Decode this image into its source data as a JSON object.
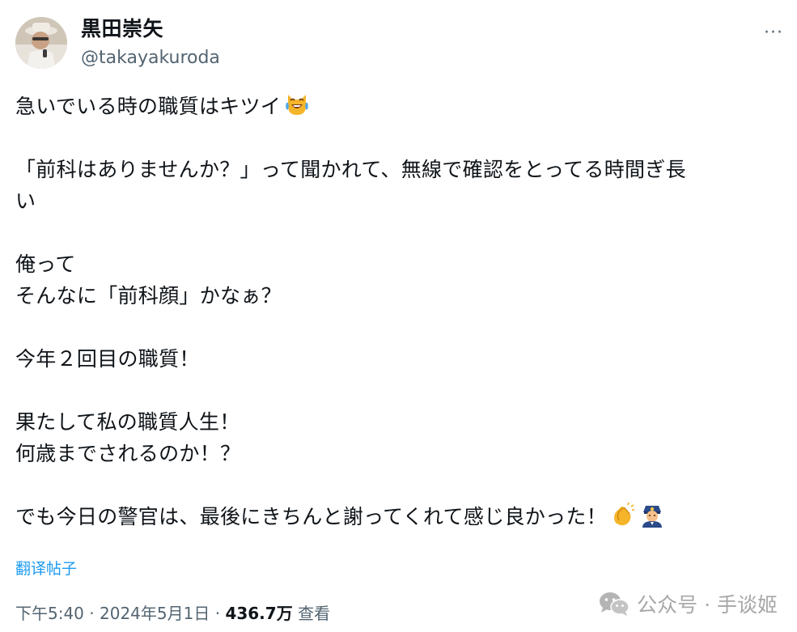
{
  "author": {
    "display_name": "黒田崇矢",
    "handle": "@takayakuroda"
  },
  "more_label": "···",
  "tweet": {
    "paragraphs": [
      {
        "lines": [
          "急いでいる時の職質はキツイ"
        ],
        "trailing_emoji": [
          "crying-laughing-cat-emoji"
        ]
      },
      {
        "lines": [
          "「前科はありませんか？」って聞かれて、無線で確認をとってる時間ぎ長",
          "い"
        ]
      },
      {
        "lines": [
          "俺って",
          "そんなに「前科顔」かなぁ？"
        ]
      },
      {
        "lines": [
          "今年２回目の職質！"
        ]
      },
      {
        "lines": [
          "果たして私の職質人生！",
          "何歳までされるのか！？"
        ]
      },
      {
        "lines": [
          "でも今日の警官は、最後にきちんと謝ってくれて感じ良かった！"
        ],
        "trailing_emoji": [
          "clapping-hands-emoji",
          "police-officer-emoji"
        ]
      }
    ]
  },
  "translate_label": "翻译帖子",
  "meta": {
    "time": "下午5:40",
    "separator": " · ",
    "date": "2024年5月1日",
    "views_count": "436.7万",
    "views_label": "查看"
  },
  "watermark": {
    "text": "公众号 · 手谈姬",
    "icon": "wechat-icon"
  },
  "colors": {
    "text": "#0f1419",
    "secondary": "#536471",
    "link": "#1d9bf0",
    "watermark": "#a7a7a7"
  }
}
